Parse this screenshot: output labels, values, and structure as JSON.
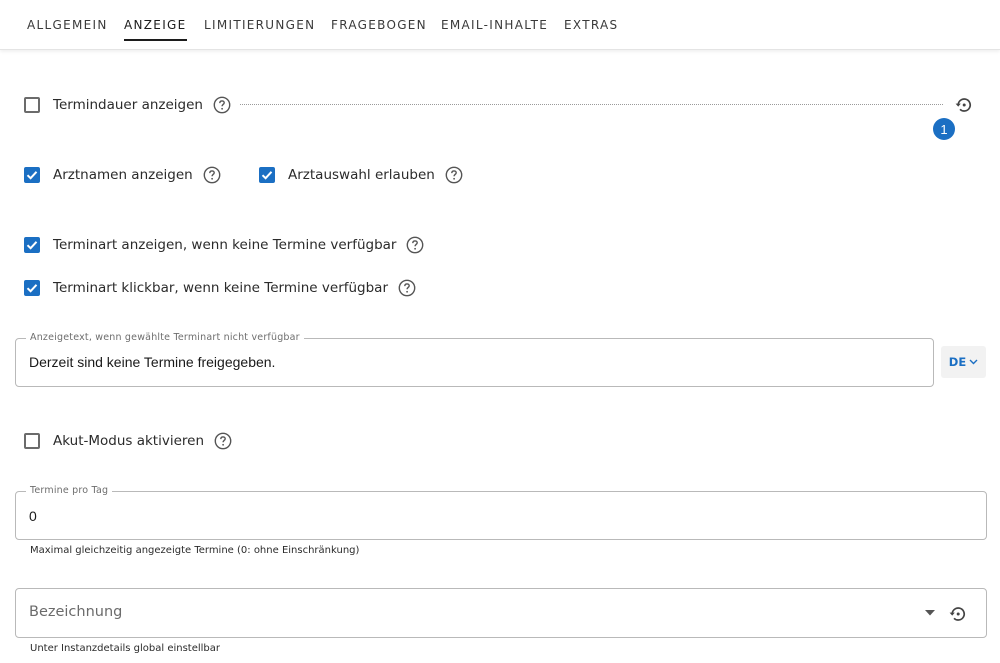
{
  "tabs": [
    {
      "label": "ALLGEMEIN"
    },
    {
      "label": "ANZEIGE"
    },
    {
      "label": "LIMITIERUNGEN"
    },
    {
      "label": "FRAGEBOGEN"
    },
    {
      "label": "EMAIL-INHALTE"
    },
    {
      "label": "EXTRAS"
    }
  ],
  "active_tab": "ANZEIGE",
  "options": {
    "termindauer": {
      "label": "Termindauer anzeigen",
      "checked": false
    },
    "arztnamen": {
      "label": "Arztnamen anzeigen",
      "checked": true
    },
    "arztauswahl": {
      "label": "Arztauswahl erlauben",
      "checked": true
    },
    "terminart_anzeigen": {
      "label": "Terminart anzeigen, wenn keine Termine verfügbar",
      "checked": true
    },
    "terminart_klickbar": {
      "label": "Terminart klickbar, wenn keine Termine verfügbar",
      "checked": true
    },
    "akut_modus": {
      "label": "Akut-Modus aktivieren",
      "checked": false
    }
  },
  "badge": {
    "count": "1"
  },
  "anzeigetext": {
    "legend": "Anzeigetext, wenn gewählte Terminart nicht verfügbar",
    "value": "Derzeit sind keine Termine freigegeben.",
    "language": "DE"
  },
  "termine_pro_tag": {
    "legend": "Termine pro Tag",
    "value": "0",
    "hint": "Maximal gleichzeitig angezeigte Termine (0: ohne Einschränkung)"
  },
  "bezeichnung": {
    "placeholder": "Bezeichnung",
    "hint": "Unter Instanzdetails global einstellbar"
  },
  "colors": {
    "accent": "#1b6fc3",
    "text": "#2b2b2b",
    "border": "#b9b9b9"
  }
}
